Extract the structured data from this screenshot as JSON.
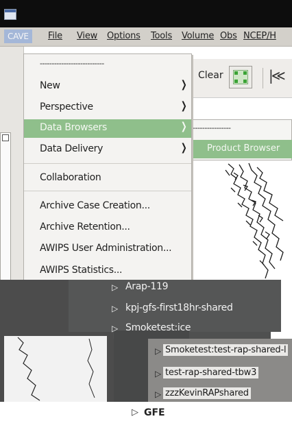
{
  "menubar": {
    "items": [
      "CAVE",
      "File",
      "View",
      "Options",
      "Tools",
      "Volume",
      "Obs",
      "NCEP/H"
    ]
  },
  "toolbar": {
    "clear_label": "Clear",
    "first_frame_glyph": "|≪"
  },
  "cave_menu": {
    "separator_text": "---------------------------",
    "items": [
      {
        "label": "New",
        "has_submenu": true
      },
      {
        "label": "Perspective",
        "has_submenu": true
      },
      {
        "label": "Data Browsers",
        "has_submenu": true,
        "selected": true
      },
      {
        "label": "Data Delivery",
        "has_submenu": true
      },
      {
        "label": "Collaboration",
        "has_submenu": false
      },
      {
        "label": "Archive Case Creation...",
        "has_submenu": false
      },
      {
        "label": "Archive Retention...",
        "has_submenu": false
      },
      {
        "label": "AWIPS User Administration...",
        "has_submenu": false
      },
      {
        "label": "AWIPS Statistics...",
        "has_submenu": false
      }
    ]
  },
  "submenu": {
    "separator_text": "----------------",
    "selected_item": "Product Browser"
  },
  "tree": {
    "rows": [
      "Arap-119",
      "kpj-gfs-first18hr-shared",
      "Smoketest:ice"
    ],
    "dataset_rows": [
      "Smoketest:test-rap-shared-l",
      "test-rap-shared-tbw3",
      "zzzKevinRAPshared"
    ],
    "gfe_label": "GFE"
  },
  "colors": {
    "selection": "#8fbf8b",
    "menu_bg": "#f4f3f1",
    "title_bar": "#0d0d0d",
    "cave_highlight": "#a4b7d8"
  }
}
